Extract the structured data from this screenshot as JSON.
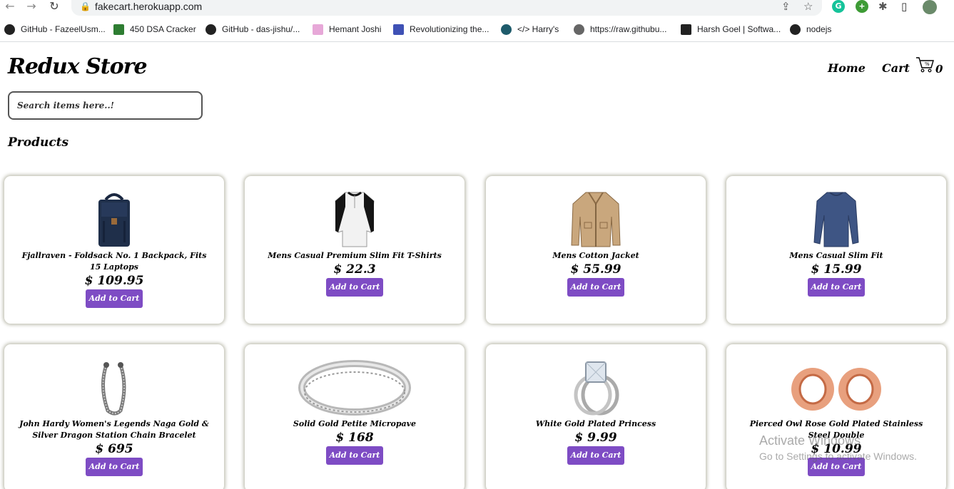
{
  "browser": {
    "url": "fakecart.herokuapp.com",
    "bookmarks": [
      {
        "label": "GitHub - FazeelUsm...",
        "icon": "github-icon"
      },
      {
        "label": "450 DSA Cracker",
        "icon": "cracker-icon"
      },
      {
        "label": "GitHub - das-jishu/...",
        "icon": "github-icon"
      },
      {
        "label": "Hemant Joshi",
        "icon": "site-icon"
      },
      {
        "label": "Revolutionizing the...",
        "icon": "site-icon"
      },
      {
        "label": "</> Harry's",
        "icon": "site-icon"
      },
      {
        "label": "https://raw.githubu...",
        "icon": "globe-icon"
      },
      {
        "label": "Harsh Goel | Softwa...",
        "icon": "site-icon"
      },
      {
        "label": "nodejs",
        "icon": "github-icon"
      }
    ]
  },
  "header": {
    "brand": "Redux Store",
    "home_label": "Home",
    "cart_label": "Cart",
    "cart_count": "0"
  },
  "search": {
    "placeholder": "Search items here..!"
  },
  "section_title": "Products",
  "products": [
    {
      "title": "Fjallraven - Foldsack No. 1 Backpack, Fits 15 Laptops",
      "price": "$ 109.95",
      "button": "Add to Cart",
      "image": "backpack"
    },
    {
      "title": "Mens Casual Premium Slim Fit T-Shirts",
      "price": "$ 22.3",
      "button": "Add to Cart",
      "image": "tshirt"
    },
    {
      "title": "Mens Cotton Jacket",
      "price": "$ 55.99",
      "button": "Add to Cart",
      "image": "jacket"
    },
    {
      "title": "Mens Casual Slim Fit",
      "price": "$ 15.99",
      "button": "Add to Cart",
      "image": "longsleeve"
    },
    {
      "title": "John Hardy Women's Legends Naga Gold & Silver Dragon Station Chain Bracelet",
      "price": "$ 695",
      "button": "Add to Cart",
      "image": "bracelet"
    },
    {
      "title": "Solid Gold Petite Micropave",
      "price": "$ 168",
      "button": "Add to Cart",
      "image": "ring"
    },
    {
      "title": "White Gold Plated Princess",
      "price": "$ 9.99",
      "button": "Add to Cart",
      "image": "diamond-ring"
    },
    {
      "title": "Pierced Owl Rose Gold Plated Stainless Steel Double",
      "price": "$ 10.99",
      "button": "Add to Cart",
      "image": "plugs"
    }
  ],
  "watermark": {
    "line1": "Activate Windows",
    "line2": "Go to Settings to activate Windows."
  },
  "colors": {
    "button": "#7e4cc4"
  }
}
